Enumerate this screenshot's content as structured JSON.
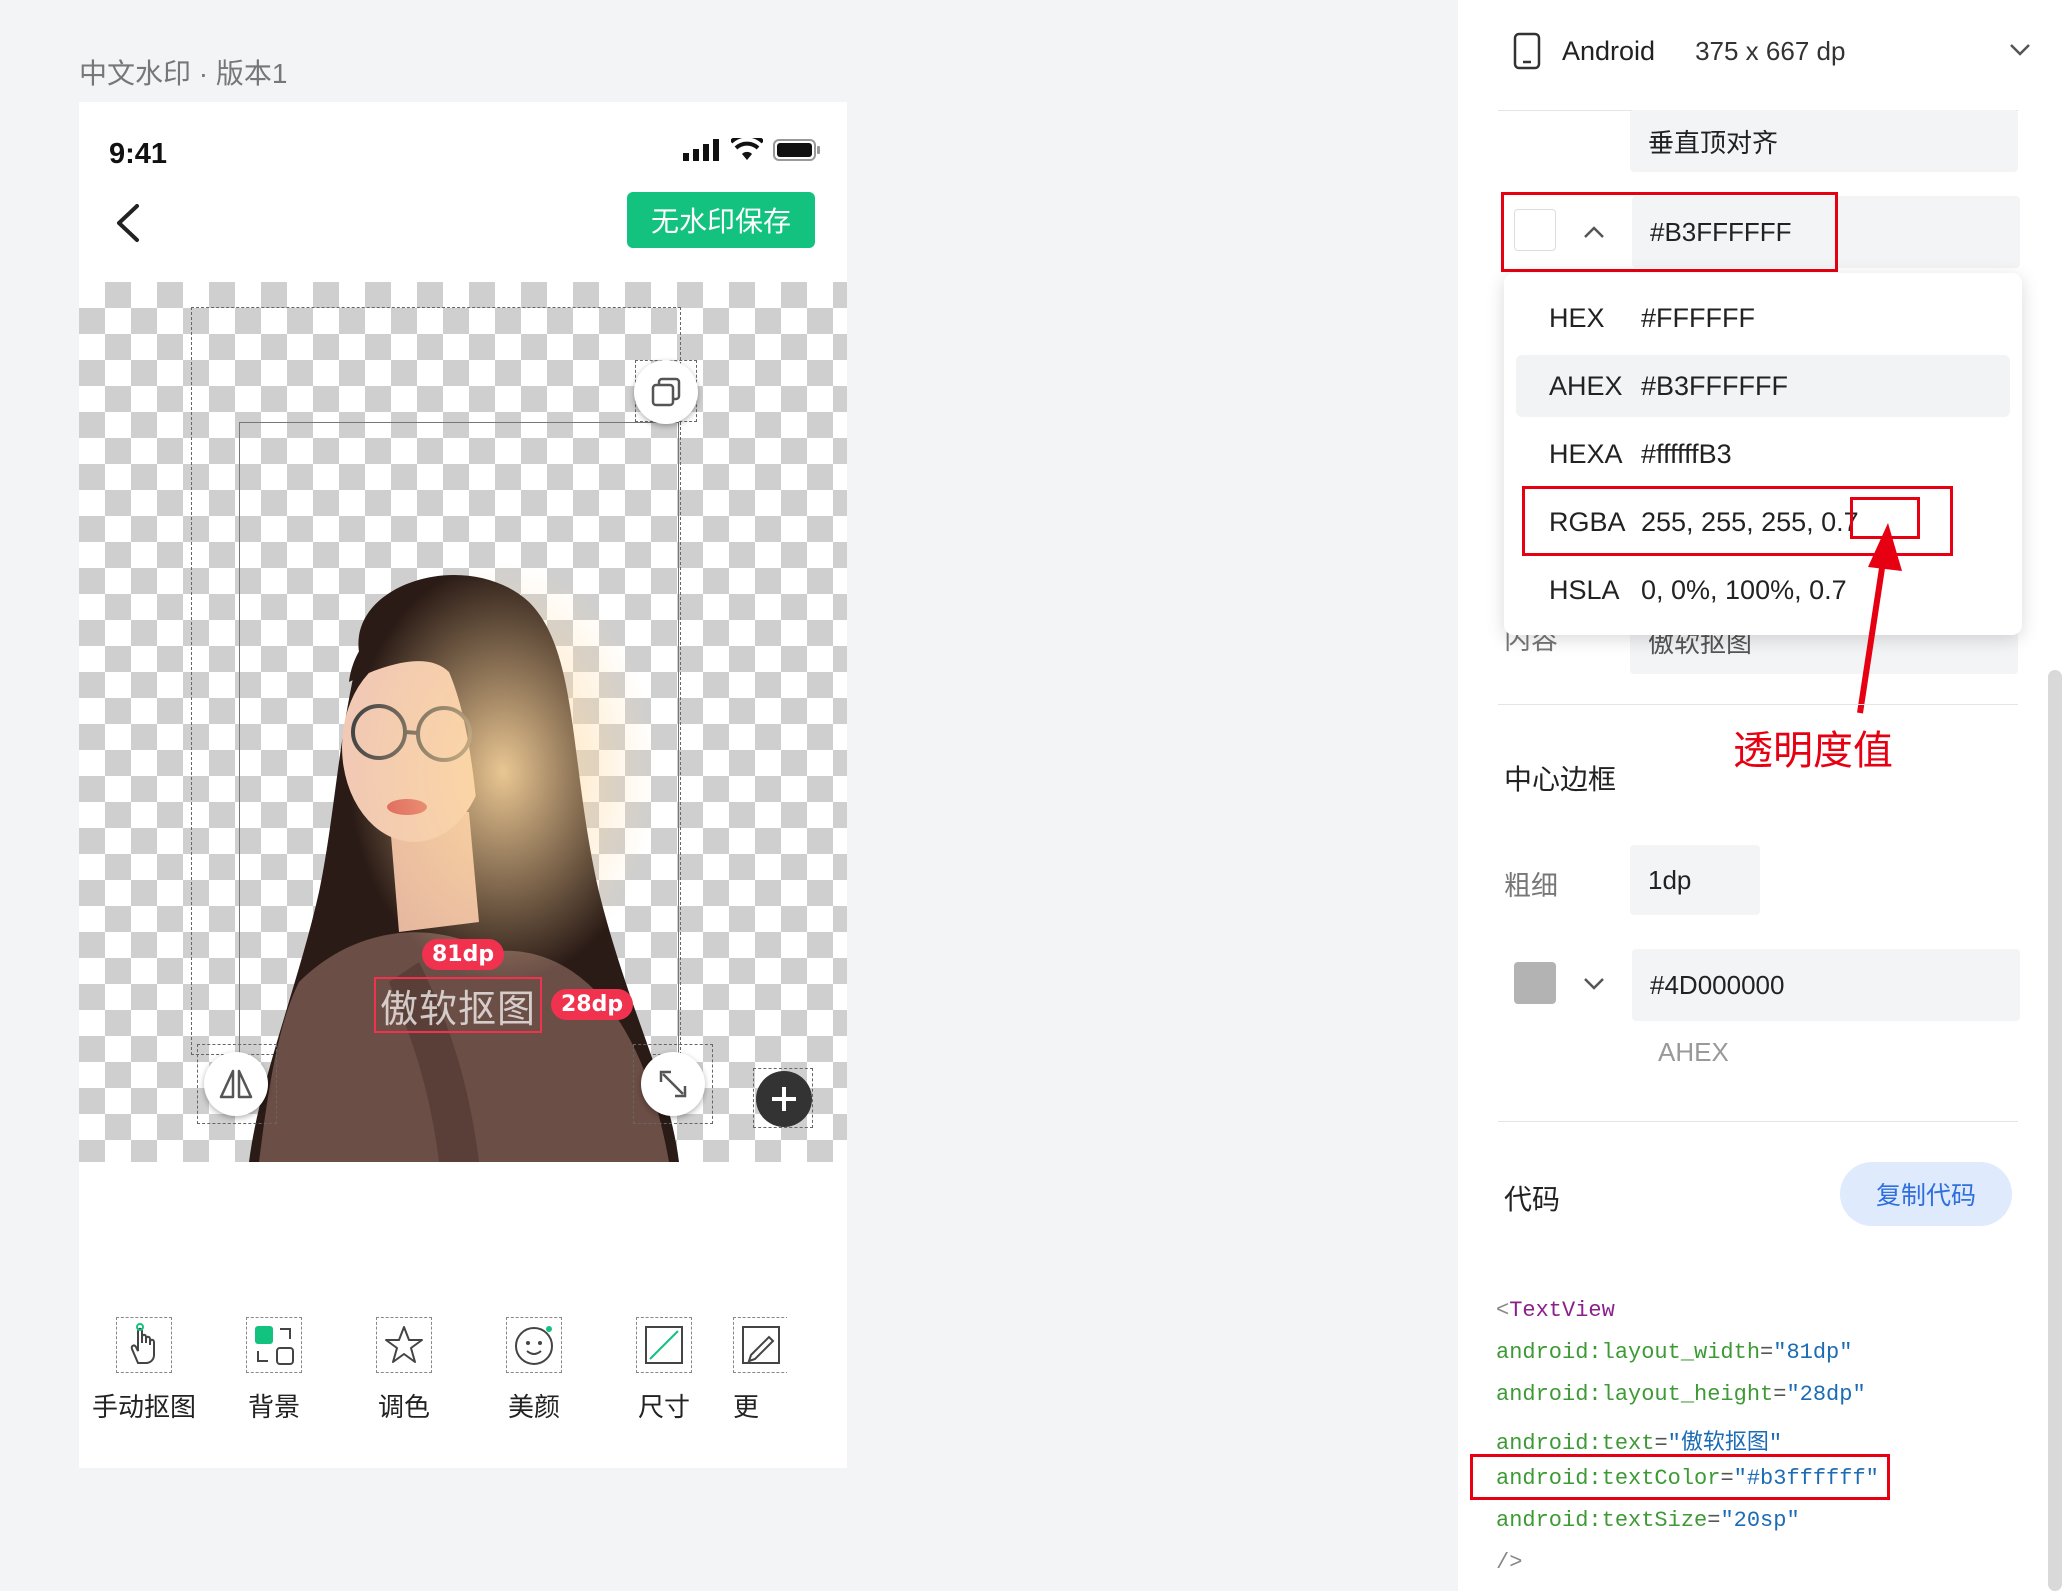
{
  "project": {
    "title": "中文水印 · 版本1"
  },
  "phone": {
    "status_time": "9:41",
    "save_button": "无水印保存",
    "watermark_text": "傲软抠图",
    "width_badge": "81dp",
    "height_badge": "28dp",
    "toolbar": [
      {
        "label": "手动抠图",
        "icon": "hand-cutout-icon"
      },
      {
        "label": "背景",
        "icon": "background-icon"
      },
      {
        "label": "调色",
        "icon": "color-adjust-icon"
      },
      {
        "label": "美颜",
        "icon": "beauty-face-icon"
      },
      {
        "label": "尺寸",
        "icon": "size-icon"
      },
      {
        "label": "更",
        "icon": "more-edit-icon"
      }
    ]
  },
  "panel": {
    "device": {
      "name": "Android",
      "size": "375 x 667 dp"
    },
    "vertical_align": "垂直顶对齐",
    "text_color": {
      "value": "#B3FFFFFF",
      "swatch": "#FFFFFF"
    },
    "format_options": [
      {
        "key": "HEX",
        "value": "#FFFFFF"
      },
      {
        "key": "AHEX",
        "value": "#B3FFFFFF"
      },
      {
        "key": "HEXA",
        "value": "#ffffffB3"
      },
      {
        "key": "RGBA",
        "value": "255, 255, 255, 0.7"
      },
      {
        "key": "HSLA",
        "value": "0, 0%, 100%, 0.7"
      }
    ],
    "content_label": "内容",
    "content_value": "傲软抠图",
    "annotation": "透明度值",
    "center_border": {
      "title": "中心边框",
      "thickness_label": "粗细",
      "thickness_value": "1dp",
      "color_value": "#4D000000",
      "color_swatch": "#b3b3b3",
      "color_format": "AHEX"
    },
    "code": {
      "title": "代码",
      "copy_button": "复制代码",
      "tag_open": "<",
      "tag_name": "TextView",
      "attrs": [
        {
          "name": "android:layout_width",
          "value": "\"81dp\""
        },
        {
          "name": "android:layout_height",
          "value": "\"28dp\""
        },
        {
          "name": "android:text",
          "value": "\"傲软抠图\""
        },
        {
          "name": "android:textColor",
          "value": "\"#b3ffffff\""
        },
        {
          "name": "android:textSize",
          "value": "\"20sp\""
        }
      ],
      "eq": "=",
      "close": "/>"
    }
  },
  "colors": {
    "accent_green": "#14c27f",
    "badge_red": "#f0324f",
    "annotation_red": "#e60012",
    "copy_btn_bg": "#dfeafd",
    "copy_btn_text": "#2f6fde"
  }
}
